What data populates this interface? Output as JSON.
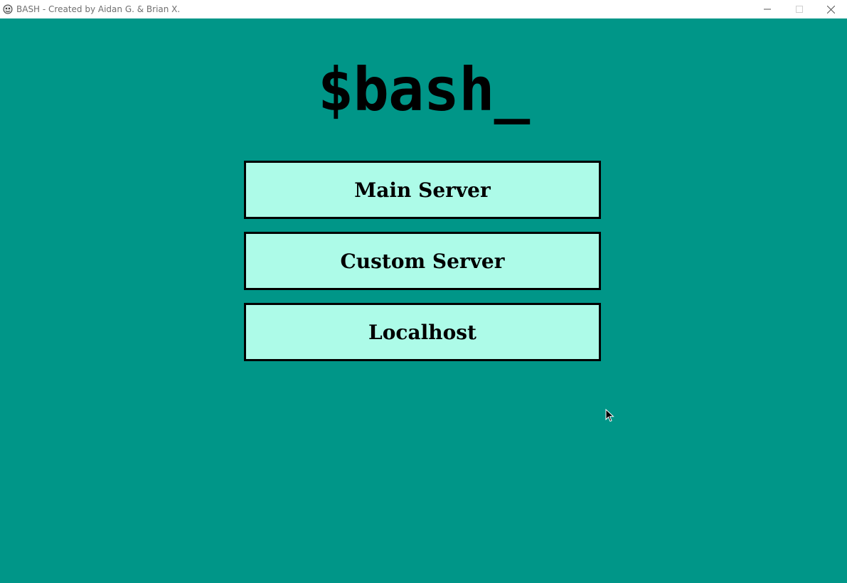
{
  "window": {
    "title": "BASH - Created by Aidan G. & Brian X.",
    "icon": "app-icon",
    "controls": [
      "minimize-icon",
      "maximize-icon",
      "close-icon"
    ]
  },
  "main": {
    "title": "$bash_",
    "buttons": [
      {
        "label": "Main Server"
      },
      {
        "label": "Custom Server"
      },
      {
        "label": "Localhost"
      }
    ]
  },
  "colors": {
    "background": "#009688",
    "button_fill": "#adfbe8",
    "button_border": "#000000",
    "text": "#000000"
  }
}
